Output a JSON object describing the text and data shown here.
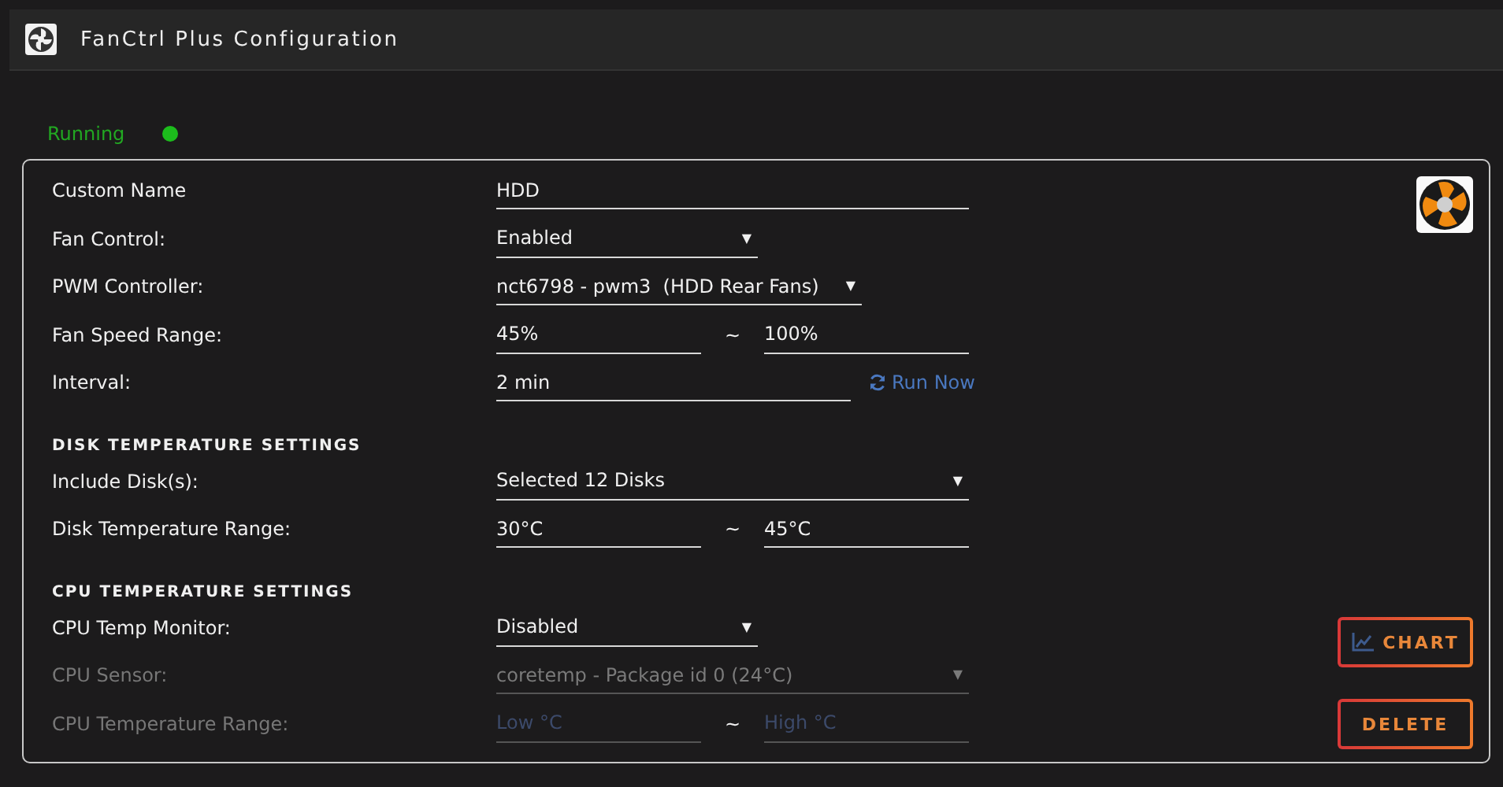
{
  "window": {
    "title": "FanCtrl Plus Configuration"
  },
  "status": {
    "label": "Running",
    "running": true
  },
  "rows": [
    {
      "kind": "field",
      "label": "Custom Name",
      "disabled": false,
      "control": {
        "kind": "text",
        "value": "HDD"
      }
    },
    {
      "kind": "field",
      "label": "Fan Control:",
      "disabled": false,
      "control": {
        "kind": "select",
        "value": "Enabled",
        "arrow": "▼"
      }
    },
    {
      "kind": "field",
      "label": "PWM Controller:",
      "disabled": false,
      "control": {
        "kind": "select",
        "value": "nct6798 - pwm3  (HDD Rear Fans)",
        "arrow": "▼"
      }
    },
    {
      "kind": "field",
      "label": "Fan Speed Range:",
      "disabled": false,
      "control": {
        "kind": "range",
        "low": {
          "value": "45%"
        },
        "separator": "~",
        "high": {
          "value": "100%"
        }
      }
    },
    {
      "kind": "field",
      "label": "Interval:",
      "disabled": false,
      "control": {
        "kind": "text",
        "value": "2 min",
        "link": "Run Now"
      }
    },
    {
      "kind": "heading",
      "label": "DISK TEMPERATURE SETTINGS"
    },
    {
      "kind": "field",
      "label": "Include Disk(s):",
      "disabled": false,
      "control": {
        "kind": "select",
        "value": "Selected 12 Disks",
        "arrow": "▼"
      }
    },
    {
      "kind": "field",
      "label": "Disk Temperature Range:",
      "disabled": false,
      "control": {
        "kind": "range",
        "low": {
          "value": "30°C"
        },
        "separator": "~",
        "high": {
          "value": "45°C"
        }
      }
    },
    {
      "kind": "heading",
      "label": "CPU TEMPERATURE SETTINGS"
    },
    {
      "kind": "field",
      "label": "CPU Temp Monitor:",
      "disabled": false,
      "control": {
        "kind": "select",
        "value": "Disabled",
        "arrow": "▼"
      }
    },
    {
      "kind": "field",
      "label": "CPU Sensor:",
      "disabled": true,
      "control": {
        "kind": "select",
        "value": "coretemp - Package id 0 (24°C)",
        "arrow": "▼"
      }
    },
    {
      "kind": "field",
      "label": "CPU Temperature Range:",
      "disabled": true,
      "control": {
        "kind": "range",
        "low": {
          "placeholder": "Low °C"
        },
        "separator": "~",
        "high": {
          "placeholder": "High °C"
        }
      }
    }
  ],
  "buttons": [
    {
      "kind": "chart",
      "label": "CHART"
    },
    {
      "kind": "delete",
      "label": "DELETE"
    }
  ]
}
